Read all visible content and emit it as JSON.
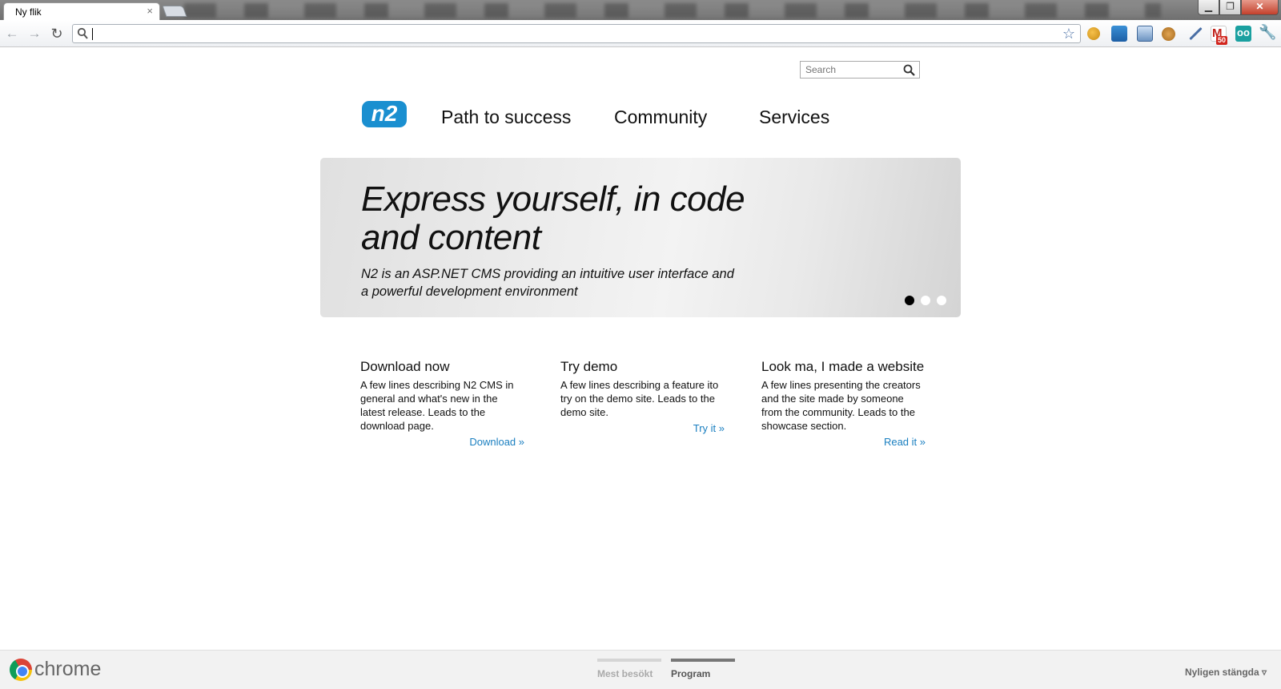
{
  "browser": {
    "tab_title": "Ny flik",
    "tab_close_icon": "×",
    "window_controls": {
      "minimize": "▁",
      "maximize": "❐",
      "close": "✕"
    },
    "nav_icons": {
      "back": "←",
      "forward": "→",
      "reload": "↻"
    },
    "address_value": "",
    "bookmark_star": "☆",
    "extension_badge": "50",
    "wrench_icon": "🔧",
    "bottom_bar": {
      "brand": "chrome",
      "tabs": [
        {
          "label": "Mest besökt",
          "active": false
        },
        {
          "label": "Program",
          "active": true
        }
      ],
      "recently_closed": "Nyligen stängda ▿"
    }
  },
  "site": {
    "search_placeholder": "Search",
    "logo_text": "n2",
    "nav": [
      "Path to success",
      "Community",
      "Services"
    ],
    "hero": {
      "title": "Express yourself, in code and content",
      "subtitle": "N2 is an ASP.NET CMS providing an intuitive user interface and a powerful development environment",
      "active_slide": 1,
      "slide_count": 3
    },
    "cards": [
      {
        "title": "Download now",
        "text": "A few lines describing N2 CMS in general and what's new in the latest release. Leads to the download page.",
        "link": "Download »"
      },
      {
        "title": "Try demo",
        "text": "A few lines describing a feature ito try on the demo site. Leads to the demo site.",
        "link": "Try it »"
      },
      {
        "title": "Look ma, I made a website",
        "text": "A few lines presenting the creators and the site made by someone from the community. Leads to the showcase section.",
        "link": "Read it »"
      }
    ]
  },
  "colors": {
    "link": "#1a7fc0",
    "logo": "#1a8fd0",
    "close_button": "#c4402c"
  }
}
